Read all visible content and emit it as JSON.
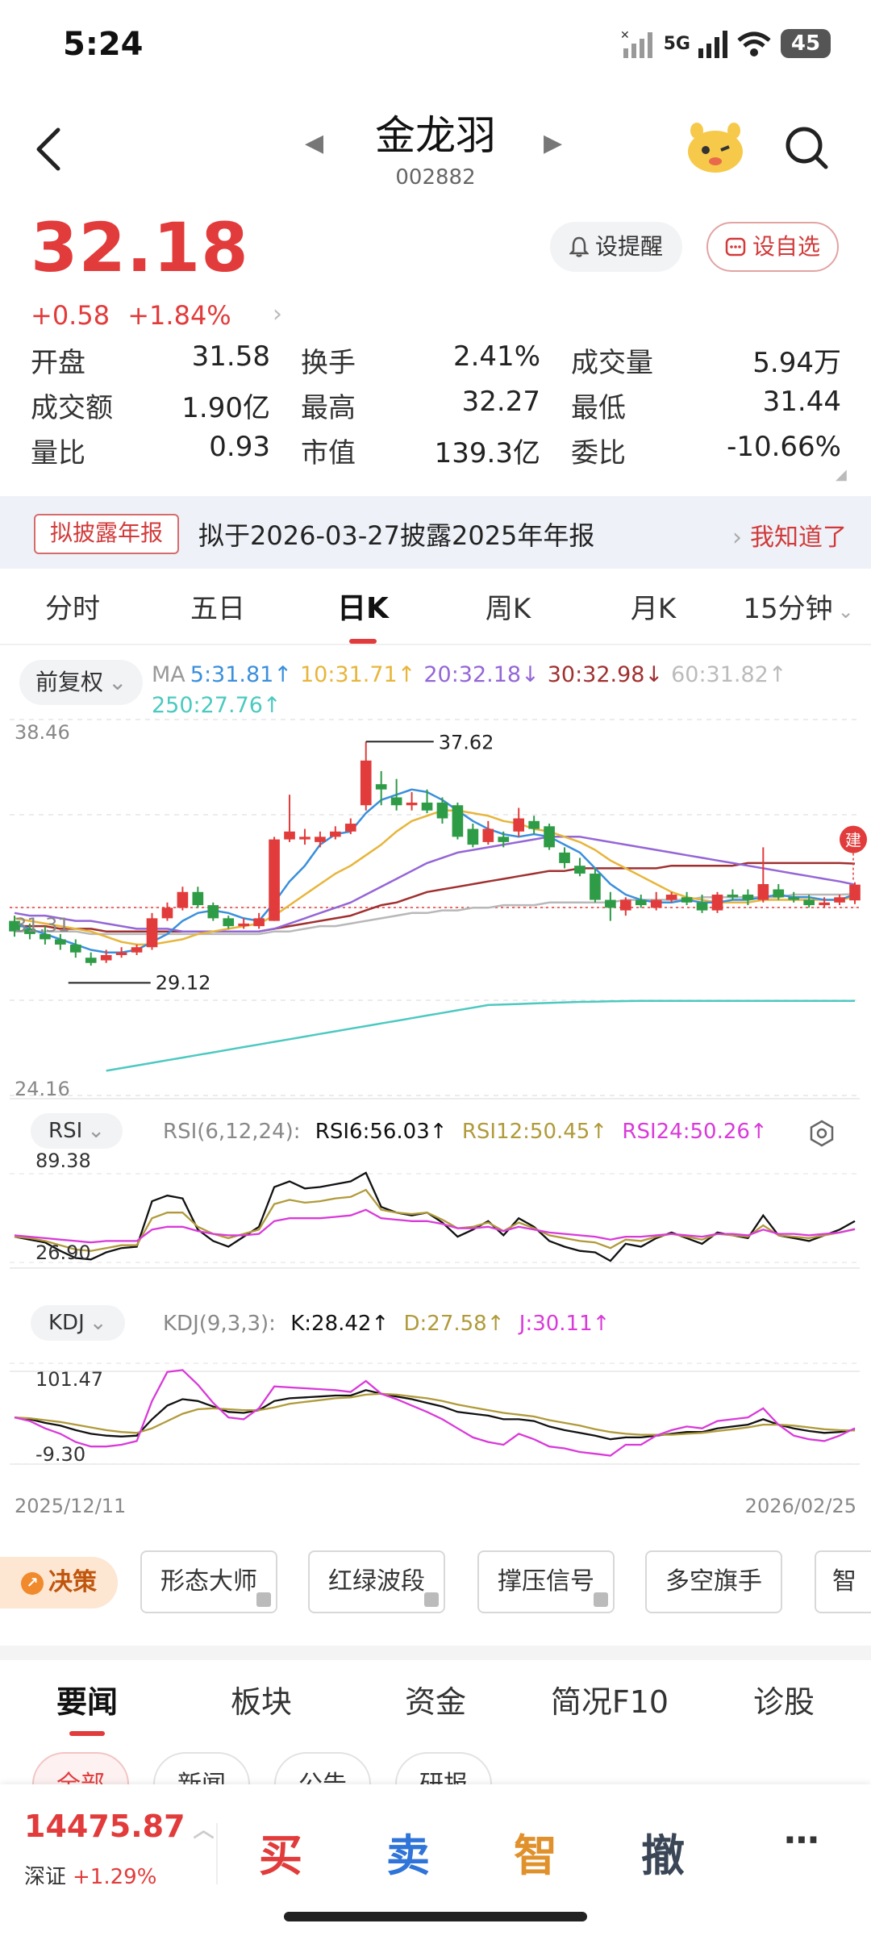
{
  "status_bar": {
    "time": "5:24",
    "network": "5G",
    "battery": "45"
  },
  "header": {
    "name": "金龙羽",
    "code": "002882"
  },
  "quote": {
    "price": "32.18",
    "change": "+0.58",
    "change_pct": "+1.84%",
    "alert_label": "设提醒",
    "watch_label": "设自选",
    "stats": [
      [
        {
          "label": "开盘",
          "value": "31.58",
          "tone": "green"
        },
        {
          "label": "换手",
          "value": "2.41%",
          "tone": "normal"
        },
        {
          "label": "成交量",
          "value": "5.94万",
          "tone": "normal"
        }
      ],
      [
        {
          "label": "成交额",
          "value": "1.90亿",
          "tone": "normal"
        },
        {
          "label": "最高",
          "value": "32.27",
          "tone": "red"
        },
        {
          "label": "最低",
          "value": "31.44",
          "tone": "green"
        }
      ],
      [
        {
          "label": "量比",
          "value": "0.93",
          "tone": "normal"
        },
        {
          "label": "市值",
          "value": "139.3亿",
          "tone": "normal"
        },
        {
          "label": "委比",
          "value": "-10.66%",
          "tone": "green"
        }
      ]
    ]
  },
  "notice": {
    "tag": "拟披露年报",
    "text": "拟于2026-03-27披露2025年年报",
    "action": "我知道了"
  },
  "period_tabs": [
    "分时",
    "五日",
    "日K",
    "周K",
    "月K",
    "15分钟"
  ],
  "active_period": 2,
  "chart_toolbar": {
    "adjust_label": "前复权"
  },
  "ma_legend": {
    "prefix": "MA",
    "ma5": "5:31.81↑",
    "ma10": "10:31.71↑",
    "ma20": "20:32.18↓",
    "ma30": "30:32.98↓",
    "ma60": "60:31.82↑",
    "ma250": "250:27.76↑"
  },
  "colors": {
    "up": "#e23b3b",
    "down": "#2e9b46",
    "ma5": "#3a8fdc",
    "ma10": "#e7b53a",
    "ma20": "#9466d6",
    "ma30": "#a03030",
    "ma60": "#b8b8b8",
    "ma250": "#4cc9c0",
    "rsi6": "#111111",
    "rsi12": "#b09a3a",
    "rsi24": "#d93ad9"
  },
  "chart_data": [
    {
      "type": "candlestick",
      "title": "日K",
      "ylim": [
        24.16,
        38.46
      ],
      "y_top_label": "38.46",
      "y_bottom_label": "24.16",
      "ref_price_label": "31.31",
      "ref_price": 31.31,
      "high_marker": "37.62",
      "high_value": 37.62,
      "low_marker": "29.12",
      "low_value": 29.12,
      "badge": "建",
      "x_start": "2025/12/11",
      "x_end": "2026/02/25",
      "candles": [
        [
          30.8,
          30.4,
          31.0,
          30.2
        ],
        [
          30.5,
          30.3,
          30.7,
          30.1
        ],
        [
          30.3,
          30.1,
          30.6,
          29.9
        ],
        [
          30.1,
          29.9,
          30.3,
          29.7
        ],
        [
          29.9,
          29.6,
          30.1,
          29.4
        ],
        [
          29.4,
          29.2,
          29.6,
          29.1
        ],
        [
          29.3,
          29.5,
          29.7,
          29.2
        ],
        [
          29.5,
          29.6,
          29.8,
          29.4
        ],
        [
          29.6,
          29.8,
          29.9,
          29.5
        ],
        [
          29.8,
          30.9,
          31.1,
          29.7
        ],
        [
          30.9,
          31.3,
          31.5,
          30.8
        ],
        [
          31.3,
          31.9,
          32.1,
          31.2
        ],
        [
          31.9,
          31.4,
          32.1,
          31.3
        ],
        [
          31.4,
          30.9,
          31.5,
          30.8
        ],
        [
          30.9,
          30.6,
          31.0,
          30.5
        ],
        [
          30.6,
          30.7,
          30.9,
          30.5
        ],
        [
          30.6,
          30.9,
          31.1,
          30.5
        ],
        [
          30.8,
          33.9,
          34.0,
          30.8
        ],
        [
          33.9,
          34.2,
          35.6,
          33.8
        ],
        [
          33.9,
          34.0,
          34.3,
          33.7
        ],
        [
          33.8,
          34.0,
          34.2,
          33.6
        ],
        [
          34.0,
          34.2,
          34.4,
          33.9
        ],
        [
          34.2,
          34.5,
          34.7,
          34.1
        ],
        [
          35.2,
          36.9,
          37.62,
          35.0
        ],
        [
          36.0,
          35.8,
          36.5,
          35.2
        ],
        [
          35.5,
          35.2,
          36.2,
          35.0
        ],
        [
          35.2,
          35.3,
          35.7,
          35.0
        ],
        [
          35.3,
          35.0,
          35.8,
          34.9
        ],
        [
          35.3,
          34.7,
          35.5,
          34.5
        ],
        [
          35.2,
          34.0,
          35.3,
          33.9
        ],
        [
          34.3,
          33.7,
          34.5,
          33.6
        ],
        [
          33.8,
          34.3,
          34.6,
          33.7
        ],
        [
          34.0,
          33.8,
          34.2,
          33.6
        ],
        [
          34.2,
          34.7,
          35.1,
          34.0
        ],
        [
          34.6,
          34.3,
          34.8,
          34.1
        ],
        [
          34.4,
          33.6,
          34.5,
          33.5
        ],
        [
          33.4,
          33.0,
          33.6,
          32.8
        ],
        [
          32.9,
          32.6,
          33.2,
          32.5
        ],
        [
          32.6,
          31.6,
          32.8,
          31.5
        ],
        [
          31.6,
          31.3,
          31.9,
          30.8
        ],
        [
          31.2,
          31.6,
          31.7,
          31.0
        ],
        [
          31.6,
          31.4,
          31.8,
          31.3
        ],
        [
          31.3,
          31.6,
          31.9,
          31.2
        ],
        [
          31.6,
          31.8,
          31.9,
          31.5
        ],
        [
          31.7,
          31.5,
          31.9,
          31.4
        ],
        [
          31.5,
          31.2,
          31.8,
          31.1
        ],
        [
          31.2,
          31.8,
          31.9,
          31.1
        ],
        [
          31.8,
          31.7,
          32.0,
          31.6
        ],
        [
          31.8,
          31.6,
          32.0,
          31.4
        ],
        [
          31.6,
          32.2,
          33.6,
          31.5
        ],
        [
          32.0,
          31.7,
          32.2,
          31.6
        ],
        [
          31.7,
          31.6,
          31.9,
          31.5
        ],
        [
          31.6,
          31.4,
          31.8,
          31.3
        ],
        [
          31.4,
          31.5,
          31.7,
          31.3
        ],
        [
          31.5,
          31.7,
          31.8,
          31.4
        ],
        [
          31.58,
          32.18,
          32.27,
          31.44
        ]
      ],
      "ma5": [
        30.7,
        30.5,
        30.3,
        30.1,
        29.9,
        29.7,
        29.6,
        29.6,
        29.7,
        30.0,
        30.3,
        30.8,
        31.1,
        31.2,
        31.1,
        30.9,
        30.8,
        31.5,
        32.3,
        32.9,
        33.7,
        34.1,
        34.2,
        34.9,
        35.4,
        35.6,
        35.8,
        35.7,
        35.4,
        35.0,
        34.6,
        34.3,
        34.1,
        34.0,
        34.1,
        34.0,
        33.7,
        33.4,
        32.8,
        32.2,
        31.8,
        31.6,
        31.5,
        31.5,
        31.6,
        31.5,
        31.5,
        31.6,
        31.6,
        31.7,
        31.8,
        31.7,
        31.7,
        31.6,
        31.6,
        31.81
      ],
      "ma10": [
        30.9,
        30.8,
        30.7,
        30.6,
        30.5,
        30.4,
        30.2,
        30.0,
        29.9,
        29.9,
        30.0,
        30.1,
        30.3,
        30.4,
        30.5,
        30.6,
        30.7,
        31.0,
        31.4,
        31.8,
        32.2,
        32.6,
        32.9,
        33.3,
        33.7,
        34.2,
        34.6,
        34.8,
        35.0,
        35.0,
        34.9,
        34.8,
        34.6,
        34.5,
        34.3,
        34.2,
        34.0,
        33.8,
        33.5,
        33.1,
        32.8,
        32.5,
        32.2,
        31.9,
        31.7,
        31.6,
        31.5,
        31.5,
        31.5,
        31.6,
        31.6,
        31.6,
        31.6,
        31.6,
        31.6,
        31.71
      ],
      "ma20": [
        31.1,
        31.0,
        31.0,
        30.9,
        30.8,
        30.8,
        30.7,
        30.6,
        30.5,
        30.5,
        30.5,
        30.4,
        30.4,
        30.4,
        30.4,
        30.4,
        30.4,
        30.5,
        30.7,
        30.9,
        31.1,
        31.3,
        31.5,
        31.8,
        32.1,
        32.4,
        32.7,
        33.0,
        33.2,
        33.4,
        33.5,
        33.6,
        33.7,
        33.8,
        33.9,
        34.0,
        34.0,
        34.0,
        33.9,
        33.8,
        33.7,
        33.6,
        33.5,
        33.4,
        33.3,
        33.2,
        33.1,
        33.0,
        32.9,
        32.8,
        32.7,
        32.6,
        32.5,
        32.4,
        32.3,
        32.18
      ],
      "ma30": [
        30.6,
        30.6,
        30.6,
        30.5,
        30.5,
        30.5,
        30.4,
        30.4,
        30.4,
        30.4,
        30.4,
        30.4,
        30.4,
        30.4,
        30.4,
        30.4,
        30.4,
        30.5,
        30.6,
        30.7,
        30.8,
        30.9,
        31.0,
        31.2,
        31.4,
        31.5,
        31.7,
        31.9,
        32.0,
        32.1,
        32.2,
        32.3,
        32.4,
        32.5,
        32.6,
        32.7,
        32.7,
        32.8,
        32.8,
        32.8,
        32.8,
        32.8,
        32.8,
        32.9,
        32.9,
        32.9,
        32.9,
        32.9,
        33.0,
        33.0,
        33.0,
        33.0,
        33.0,
        33.0,
        33.0,
        32.98
      ],
      "ma60": [
        30.4,
        30.4,
        30.4,
        30.4,
        30.4,
        30.3,
        30.3,
        30.3,
        30.3,
        30.3,
        30.3,
        30.3,
        30.3,
        30.3,
        30.3,
        30.3,
        30.3,
        30.4,
        30.4,
        30.5,
        30.6,
        30.6,
        30.7,
        30.8,
        30.9,
        31.0,
        31.1,
        31.1,
        31.2,
        31.2,
        31.3,
        31.3,
        31.4,
        31.4,
        31.4,
        31.5,
        31.5,
        31.5,
        31.5,
        31.5,
        31.6,
        31.6,
        31.6,
        31.6,
        31.6,
        31.7,
        31.7,
        31.7,
        31.7,
        31.7,
        31.7,
        31.8,
        31.8,
        31.8,
        31.8,
        31.82
      ],
      "ma250_start_index": 6,
      "ma250": [
        25.1,
        25.2,
        25.3,
        25.4,
        25.5,
        25.6,
        25.7,
        25.8,
        25.9,
        26.0,
        26.1,
        26.2,
        26.3,
        26.4,
        26.5,
        26.6,
        26.7,
        26.8,
        26.9,
        27.0,
        27.1,
        27.2,
        27.3,
        27.4,
        27.5,
        27.6,
        27.62,
        27.64,
        27.66,
        27.68,
        27.7,
        27.72,
        27.73,
        27.74,
        27.75,
        27.76,
        27.76,
        27.76,
        27.76,
        27.76,
        27.76,
        27.76,
        27.76,
        27.76,
        27.76,
        27.76,
        27.76,
        27.76,
        27.76,
        27.76
      ]
    },
    {
      "type": "line",
      "title": "RSI(6,12,24):",
      "button": "RSI",
      "ylim": [
        26.9,
        89.38
      ],
      "y_top_label": "89.38",
      "y_bottom_label": "26.90",
      "legend": {
        "rsi6": "RSI6:56.03↑",
        "rsi12": "RSI12:50.45↑",
        "rsi24": "RSI24:50.26↑"
      },
      "series": [
        {
          "name": "RSI6",
          "values": [
            45,
            43,
            41,
            35,
            30,
            29,
            34,
            37,
            38,
            70,
            74,
            72,
            50,
            42,
            38,
            45,
            52,
            80,
            84,
            79,
            80,
            82,
            84,
            90,
            66,
            62,
            60,
            62,
            55,
            45,
            50,
            56,
            46,
            58,
            52,
            42,
            38,
            35,
            34,
            28,
            40,
            38,
            44,
            48,
            44,
            40,
            48,
            46,
            44,
            60,
            46,
            44,
            42,
            46,
            50,
            56
          ]
        },
        {
          "name": "RSI12",
          "values": [
            45,
            44,
            42,
            39,
            36,
            35,
            37,
            39,
            39,
            58,
            62,
            62,
            52,
            47,
            44,
            47,
            50,
            68,
            71,
            69,
            70,
            72,
            73,
            78,
            64,
            62,
            61,
            62,
            57,
            51,
            52,
            55,
            49,
            55,
            51,
            46,
            44,
            42,
            41,
            37,
            43,
            42,
            45,
            47,
            45,
            43,
            47,
            46,
            45,
            53,
            46,
            45,
            44,
            46,
            48,
            50.45
          ]
        },
        {
          "name": "RSI24",
          "values": [
            46,
            45,
            44,
            43,
            42,
            41,
            42,
            42,
            42,
            50,
            52,
            52,
            49,
            47,
            46,
            46,
            47,
            56,
            58,
            58,
            58,
            59,
            60,
            64,
            58,
            57,
            56,
            56,
            54,
            51,
            51,
            52,
            49,
            52,
            50,
            48,
            47,
            46,
            45,
            43,
            45,
            45,
            46,
            47,
            46,
            45,
            47,
            47,
            46,
            50,
            47,
            47,
            46,
            47,
            48,
            50.26
          ]
        }
      ]
    },
    {
      "type": "line",
      "title": "KDJ(9,3,3):",
      "button": "KDJ",
      "ylim": [
        -9.3,
        101.47
      ],
      "y_top_label": "101.47",
      "y_bottom_label": "-9.30",
      "legend": {
        "k": "K:28.42↑",
        "d": "D:27.58↑",
        "j": "J:30.11↑"
      },
      "series": [
        {
          "name": "K",
          "values": [
            42,
            40,
            36,
            33,
            28,
            24,
            22,
            21,
            22,
            40,
            55,
            62,
            60,
            54,
            48,
            47,
            50,
            60,
            63,
            64,
            65,
            66,
            66,
            72,
            68,
            65,
            62,
            58,
            54,
            48,
            46,
            44,
            40,
            40,
            38,
            32,
            28,
            25,
            22,
            18,
            20,
            20,
            22,
            24,
            26,
            26,
            30,
            32,
            34,
            40,
            34,
            30,
            27,
            25,
            26,
            28.42
          ]
        },
        {
          "name": "D",
          "values": [
            42,
            41,
            39,
            37,
            34,
            31,
            28,
            26,
            25,
            30,
            38,
            46,
            51,
            52,
            51,
            50,
            50,
            53,
            57,
            59,
            61,
            63,
            64,
            67,
            68,
            67,
            65,
            63,
            60,
            56,
            53,
            50,
            47,
            45,
            43,
            39,
            36,
            33,
            29,
            26,
            24,
            23,
            23,
            23,
            24,
            25,
            27,
            29,
            31,
            34,
            34,
            33,
            31,
            29,
            28,
            27.58
          ]
        },
        {
          "name": "J",
          "values": [
            42,
            38,
            30,
            24,
            15,
            10,
            10,
            12,
            16,
            60,
            92,
            94,
            78,
            58,
            42,
            40,
            52,
            76,
            75,
            74,
            73,
            72,
            70,
            82,
            68,
            62,
            55,
            48,
            40,
            30,
            20,
            15,
            12,
            24,
            18,
            10,
            8,
            4,
            2,
            0,
            12,
            12,
            22,
            28,
            32,
            30,
            38,
            40,
            42,
            52,
            34,
            22,
            18,
            16,
            22,
            30.11
          ]
        }
      ]
    }
  ],
  "strategy_tools": {
    "badge": "决策",
    "items": [
      "形态大师",
      "红绿波段",
      "撑压信号",
      "多空旗手",
      "智能"
    ]
  },
  "news_tabs": [
    "要闻",
    "板块",
    "资金",
    "简况F10",
    "诊股"
  ],
  "news_subtabs": [
    "全部",
    "新闻",
    "公告",
    "研报"
  ],
  "index_ticker": {
    "value": "14475.87",
    "name": "深证",
    "change_pct": "+1.29%"
  },
  "trade_buttons": {
    "buy": "买",
    "sell": "卖",
    "smart": "智",
    "cancel": "撤",
    "more": "⋯"
  }
}
